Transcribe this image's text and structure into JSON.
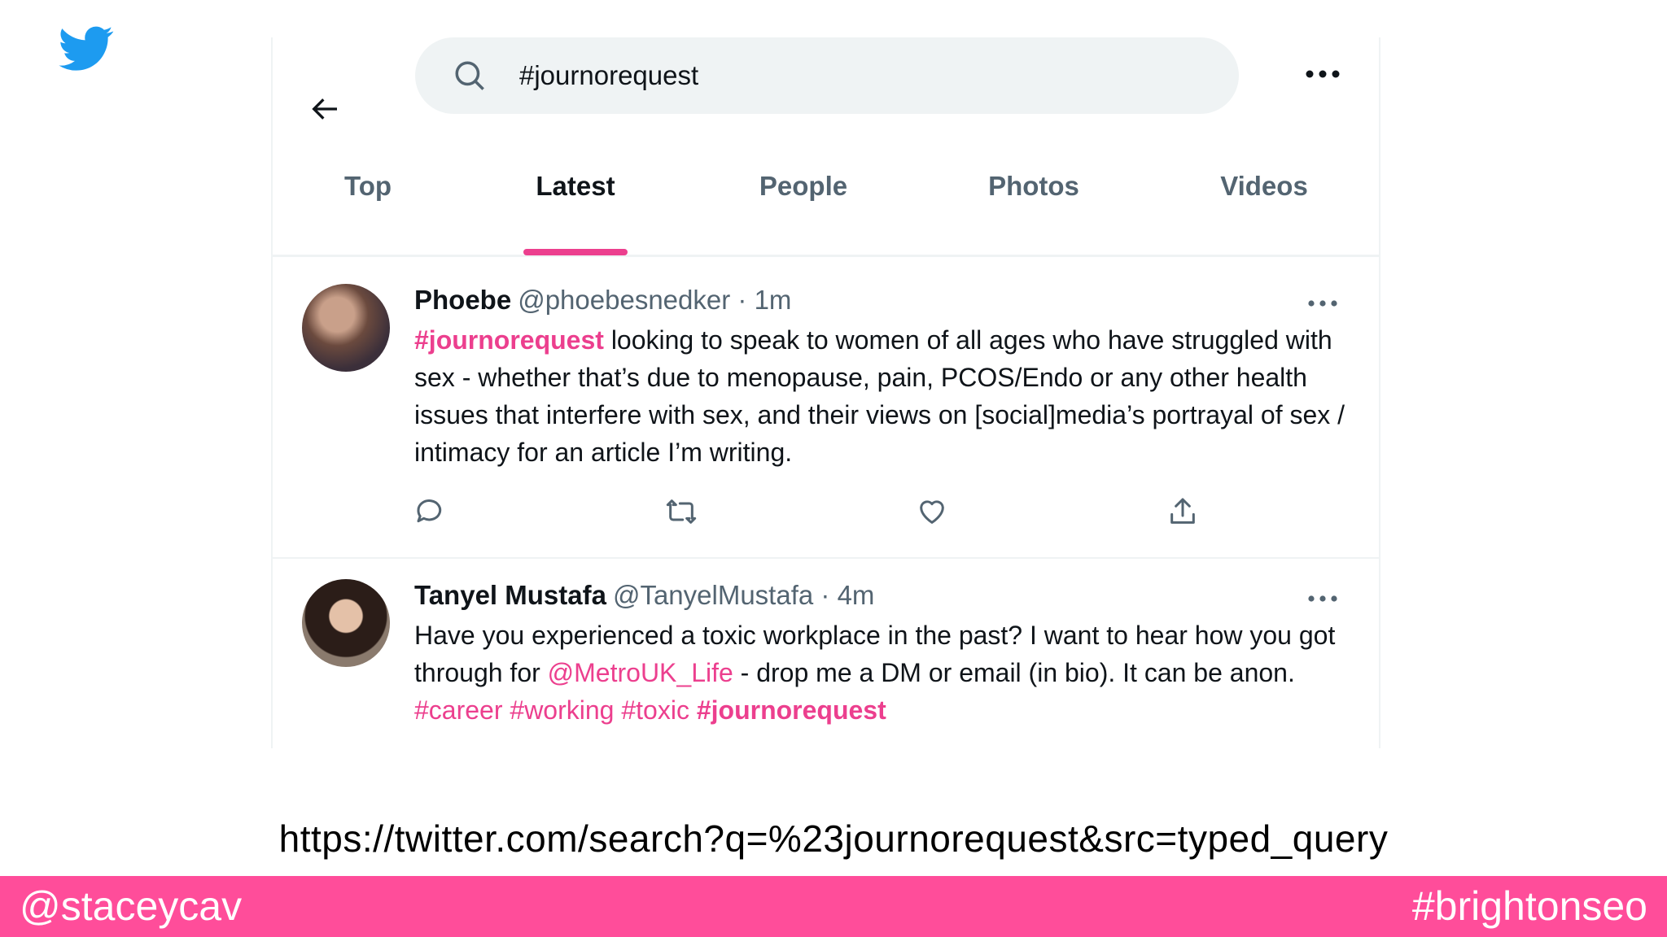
{
  "search": {
    "query": "#journorequest"
  },
  "tabs": [
    "Top",
    "Latest",
    "People",
    "Photos",
    "Videos"
  ],
  "active_tab": "Latest",
  "tweets": [
    {
      "name": "Phoebe",
      "handle": "@phoebesnedker",
      "time": "1m",
      "text_parts": [
        {
          "t": "#journorequest",
          "k": "tag"
        },
        {
          "t": " looking to speak to women of all ages who have struggled with sex - whether that’s due to menopause, pain, PCOS/Endo or any other health issues that interfere with sex, and their views on [social]media’s portrayal of sex / intimacy for an article I’m writing.",
          "k": "plain"
        }
      ]
    },
    {
      "name": "Tanyel Mustafa",
      "handle": "@TanyelMustafa",
      "time": "4m",
      "text_parts": [
        {
          "t": "Have you experienced a toxic workplace in the past? I want to hear how you got through for ",
          "k": "plain"
        },
        {
          "t": "@MetroUK_Life",
          "k": "link"
        },
        {
          "t": " - drop me a DM or email (in bio). It can be anon. ",
          "k": "plain"
        },
        {
          "t": "#career #working #toxic",
          "k": "link"
        },
        {
          "t": " ",
          "k": "plain"
        },
        {
          "t": "#journorequest",
          "k": "tag"
        }
      ]
    }
  ],
  "slide": {
    "url": "https://twitter.com/search?q=%23journorequest&src=typed_query",
    "footer_left": "@staceycav",
    "footer_right": "#brightonseo"
  },
  "colors": {
    "brand_twitter": "#1d9bf0",
    "accent_pink": "#ec3f8e",
    "footer_pink": "#ff4d9a"
  },
  "icons": [
    "twitter-bird-icon",
    "back-arrow-icon",
    "search-icon",
    "more-icon",
    "reply-icon",
    "retweet-icon",
    "like-icon",
    "share-icon"
  ]
}
